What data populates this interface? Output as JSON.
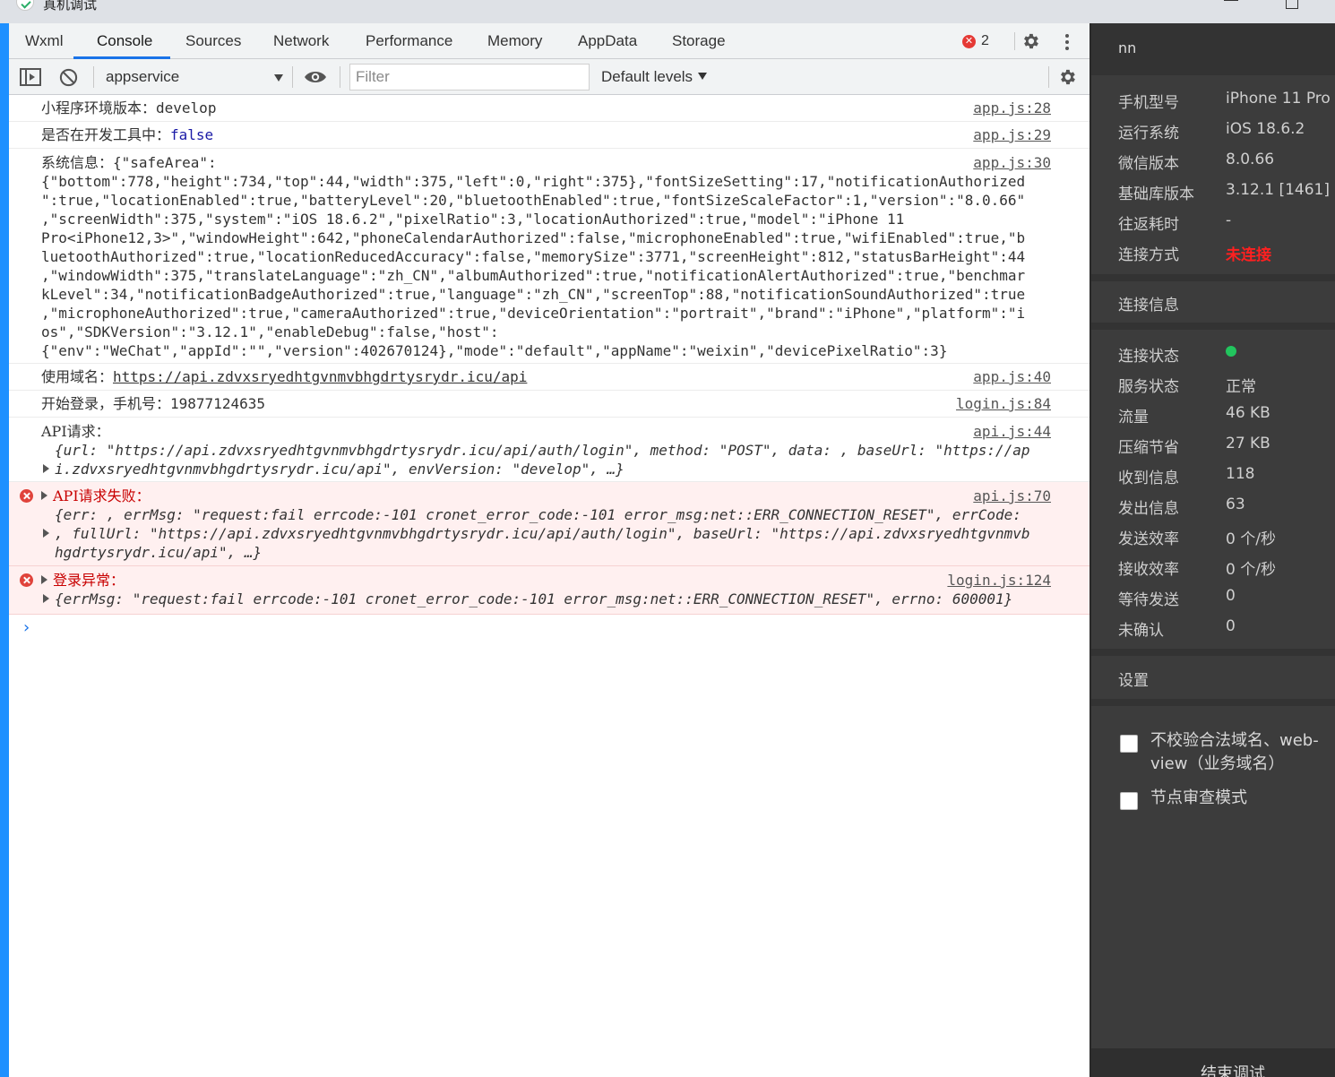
{
  "window": {
    "title": "真机调试"
  },
  "tabs": [
    {
      "label": "Wxml"
    },
    {
      "label": "Console"
    },
    {
      "label": "Sources"
    },
    {
      "label": "Network"
    },
    {
      "label": "Performance"
    },
    {
      "label": "Memory"
    },
    {
      "label": "AppData"
    },
    {
      "label": "Storage"
    }
  ],
  "active_tab": "Console",
  "error_count": "2",
  "toolbar": {
    "context": "appservice",
    "filter_placeholder": "Filter",
    "levels": "Default levels"
  },
  "messages": {
    "m1": {
      "label": "小程序环境版本：",
      "value": "develop",
      "src": "app.js:28"
    },
    "m2": {
      "label": "是否在开发工具中：",
      "value": "false",
      "src": "app.js:29"
    },
    "m3": {
      "label": "系统信息：",
      "lines": [
        "{\"safeArea\":",
        "{\"bottom\":778,\"height\":734,\"top\":44,\"width\":375,\"left\":0,\"right\":375},\"fontSizeSetting\":17,\"notificationAuthorized",
        "\":true,\"locationEnabled\":true,\"batteryLevel\":20,\"bluetoothEnabled\":true,\"fontSizeScaleFactor\":1,\"version\":\"8.0.66\"",
        ",\"screenWidth\":375,\"system\":\"iOS 18.6.2\",\"pixelRatio\":3,\"locationAuthorized\":true,\"model\":\"iPhone 11",
        "Pro<iPhone12,3>\",\"windowHeight\":642,\"phoneCalendarAuthorized\":false,\"microphoneEnabled\":true,\"wifiEnabled\":true,\"b",
        "luetoothAuthorized\":true,\"locationReducedAccuracy\":false,\"memorySize\":3771,\"screenHeight\":812,\"statusBarHeight\":44",
        ",\"windowWidth\":375,\"translateLanguage\":\"zh_CN\",\"albumAuthorized\":true,\"notificationAlertAuthorized\":true,\"benchmar",
        "kLevel\":34,\"notificationBadgeAuthorized\":true,\"language\":\"zh_CN\",\"screenTop\":88,\"notificationSoundAuthorized\":true",
        ",\"microphoneAuthorized\":true,\"cameraAuthorized\":true,\"deviceOrientation\":\"portrait\",\"brand\":\"iPhone\",\"platform\":\"i",
        "os\",\"SDKVersion\":\"3.12.1\",\"enableDebug\":false,\"host\":",
        "{\"env\":\"WeChat\",\"appId\":\"\",\"version\":402670124},\"mode\":\"default\",\"appName\":\"weixin\",\"devicePixelRatio\":3}"
      ],
      "src": "app.js:30"
    },
    "m4": {
      "label": "使用域名：",
      "value": "https://api.zdvxsryedhtgvnmvbhgdrtysrydr.icu/api",
      "src": "app.js:40"
    },
    "m5": {
      "label": "开始登录，手机号：",
      "value": "19877124635",
      "src": "login.js:84"
    },
    "m6": {
      "label": "API请求：",
      "obj_line1": "{url: \"https://api.zdvxsryedhtgvnmvbhgdrtysrydr.icu/api/auth/login\", method: \"POST\", data: , baseUrl: \"https://ap",
      "obj_line2": "i.zdvxsryedhtgvnmvbhgdrtysrydr.icu/api\", envVersion: \"develop\", …}",
      "src": "api.js:44"
    },
    "m7": {
      "label": "API请求失败：",
      "obj_line1": "{err: , errMsg: \"request:fail errcode:-101 cronet_error_code:-101 error_msg:net::ERR_CONNECTION_RESET\", errCode:",
      "obj_line2": ", fullUrl: \"https://api.zdvxsryedhtgvnmvbhgdrtysrydr.icu/api/auth/login\", baseUrl: \"https://api.zdvxsryedhtgvnmvb",
      "obj_line3": "hgdrtysrydr.icu/api\", …}",
      "src": "api.js:70"
    },
    "m8": {
      "label": "登录异常：",
      "obj_line1": "{errMsg: \"request:fail errcode:-101 cronet_error_code:-101 error_msg:net::ERR_CONNECTION_RESET\", errno: 600001}",
      "src": "login.js:124"
    }
  },
  "panel": {
    "name": "nn",
    "device": [
      {
        "label": "手机型号",
        "value": "iPhone 11 Pro"
      },
      {
        "label": "运行系统",
        "value": "iOS 18.6.2"
      },
      {
        "label": "微信版本",
        "value": "8.0.66"
      },
      {
        "label": "基础库版本",
        "value": "3.12.1 [1461]"
      },
      {
        "label": "往返耗时",
        "value": "-"
      },
      {
        "label": "连接方式",
        "value": "未连接"
      }
    ],
    "conn_section": "连接信息",
    "conn": [
      {
        "label": "连接状态",
        "value": ""
      },
      {
        "label": "服务状态",
        "value": "正常"
      },
      {
        "label": "流量",
        "value": "46 KB"
      },
      {
        "label": "压缩节省",
        "value": "27 KB"
      },
      {
        "label": "收到信息",
        "value": "118"
      },
      {
        "label": "发出信息",
        "value": "63"
      },
      {
        "label": "发送效率",
        "value": "0 个/秒"
      },
      {
        "label": "接收效率",
        "value": "0 个/秒"
      },
      {
        "label": "等待发送",
        "value": "0"
      },
      {
        "label": "未确认",
        "value": "0"
      }
    ],
    "settings_section": "设置",
    "options": [
      {
        "label": "不校验合法域名、web-view（业务域名）"
      },
      {
        "label": "节点审查模式"
      }
    ],
    "end_button": "结束调试"
  }
}
